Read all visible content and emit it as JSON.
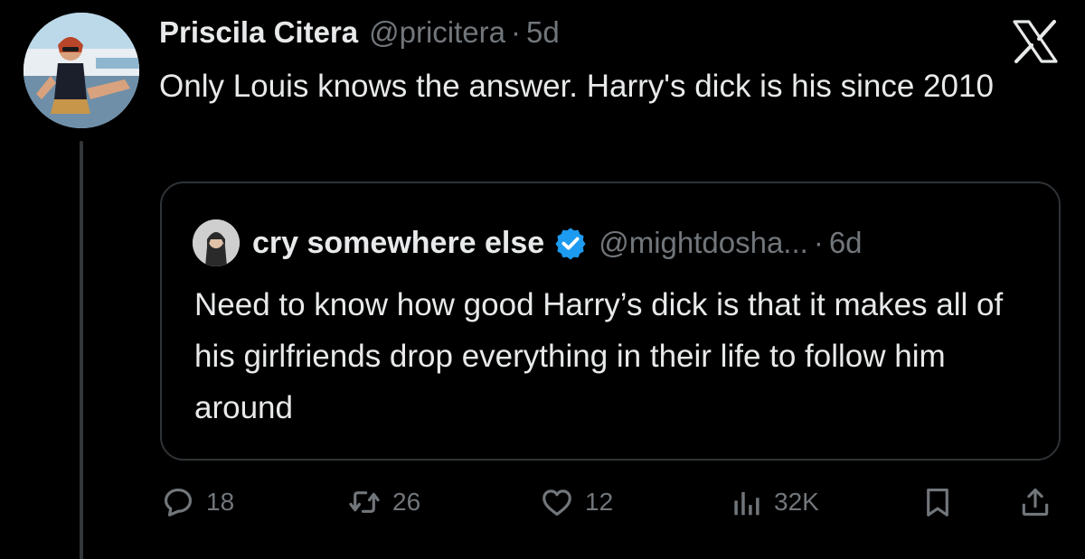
{
  "tweet": {
    "author_name": "Priscila Citera",
    "author_handle": "@pricitera",
    "separator": "·",
    "time": "5d",
    "text": "Only Louis knows the answer. Harry's dick is his since 2010",
    "avatar_icon": "user-photo-avatar"
  },
  "quoted_tweet": {
    "author_name": "cry somewhere else",
    "author_handle": "@mightdosha...",
    "separator": "·",
    "time": "6d",
    "verified": true,
    "verified_color": "#1d9bf0",
    "text": "Need to know how good Harry’s dick is that it makes all of his girlfriends drop everything in their life to follow him around",
    "avatar_icon": "user-photo-avatar"
  },
  "actions": {
    "replies": "18",
    "retweets": "26",
    "likes": "12",
    "views": "32K"
  },
  "icons": {
    "brand": "x-logo-icon",
    "reply": "reply-icon",
    "retweet": "retweet-icon",
    "like": "heart-icon",
    "views": "views-chart-icon",
    "bookmark": "bookmark-icon",
    "share": "share-icon"
  },
  "colors": {
    "background": "#000000",
    "primary_text": "#e7e9ea",
    "secondary_text": "#71767b",
    "border": "#2f3336",
    "accent": "#1d9bf0"
  }
}
